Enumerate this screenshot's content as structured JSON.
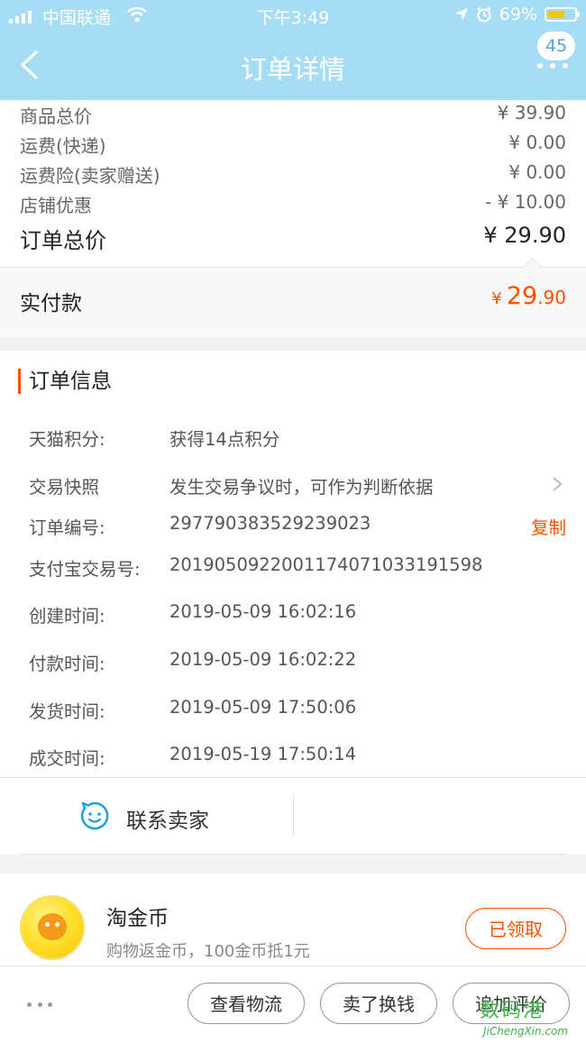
{
  "status_bar": {
    "carrier": "中国联通",
    "time": "下午3:49",
    "battery": "69%",
    "battery_level": 0.69
  },
  "nav": {
    "title": "订单详情",
    "badge": "45"
  },
  "price": {
    "rows": [
      {
        "label": "商品总价",
        "value": "¥ 39.90"
      },
      {
        "label": "运费(快递)",
        "value": "¥ 0.00"
      },
      {
        "label": "运费险(卖家赠送)",
        "value": "¥ 0.00"
      },
      {
        "label": "店铺优惠",
        "value": "- ¥ 10.00"
      }
    ],
    "total_label": "订单总价",
    "total_value": "¥ 29.90",
    "paid_label": "实付款",
    "paid_currency": "¥",
    "paid_int": "29",
    "paid_dec": ".90"
  },
  "order_info": {
    "title": "订单信息",
    "rows": [
      {
        "key": "天猫积分:",
        "value": "获得14点积分"
      },
      {
        "key": "交易快照",
        "value": "发生交易争议时，可作为判断依据"
      },
      {
        "key": "订单编号:",
        "value": "297790383529239023",
        "action": "复制"
      },
      {
        "key": "支付宝交易号:",
        "value": "2019050922001174071033191598"
      },
      {
        "key": "创建时间:",
        "value": "2019-05-09 16:02:16"
      },
      {
        "key": "付款时间:",
        "value": "2019-05-09 16:02:22"
      },
      {
        "key": "发货时间:",
        "value": "2019-05-09 17:50:06"
      },
      {
        "key": "成交时间:",
        "value": "2019-05-19 17:50:14"
      }
    ],
    "contact_label": "联系卖家"
  },
  "coin": {
    "title": "淘金币",
    "subtitle": "购物返金币，100金币抵1元",
    "button": "已领取"
  },
  "bottom": {
    "buttons": [
      "查看物流",
      "卖了换钱",
      "追加评价"
    ]
  },
  "watermark": {
    "text": "数码港",
    "url": "JiChengXin.com"
  }
}
